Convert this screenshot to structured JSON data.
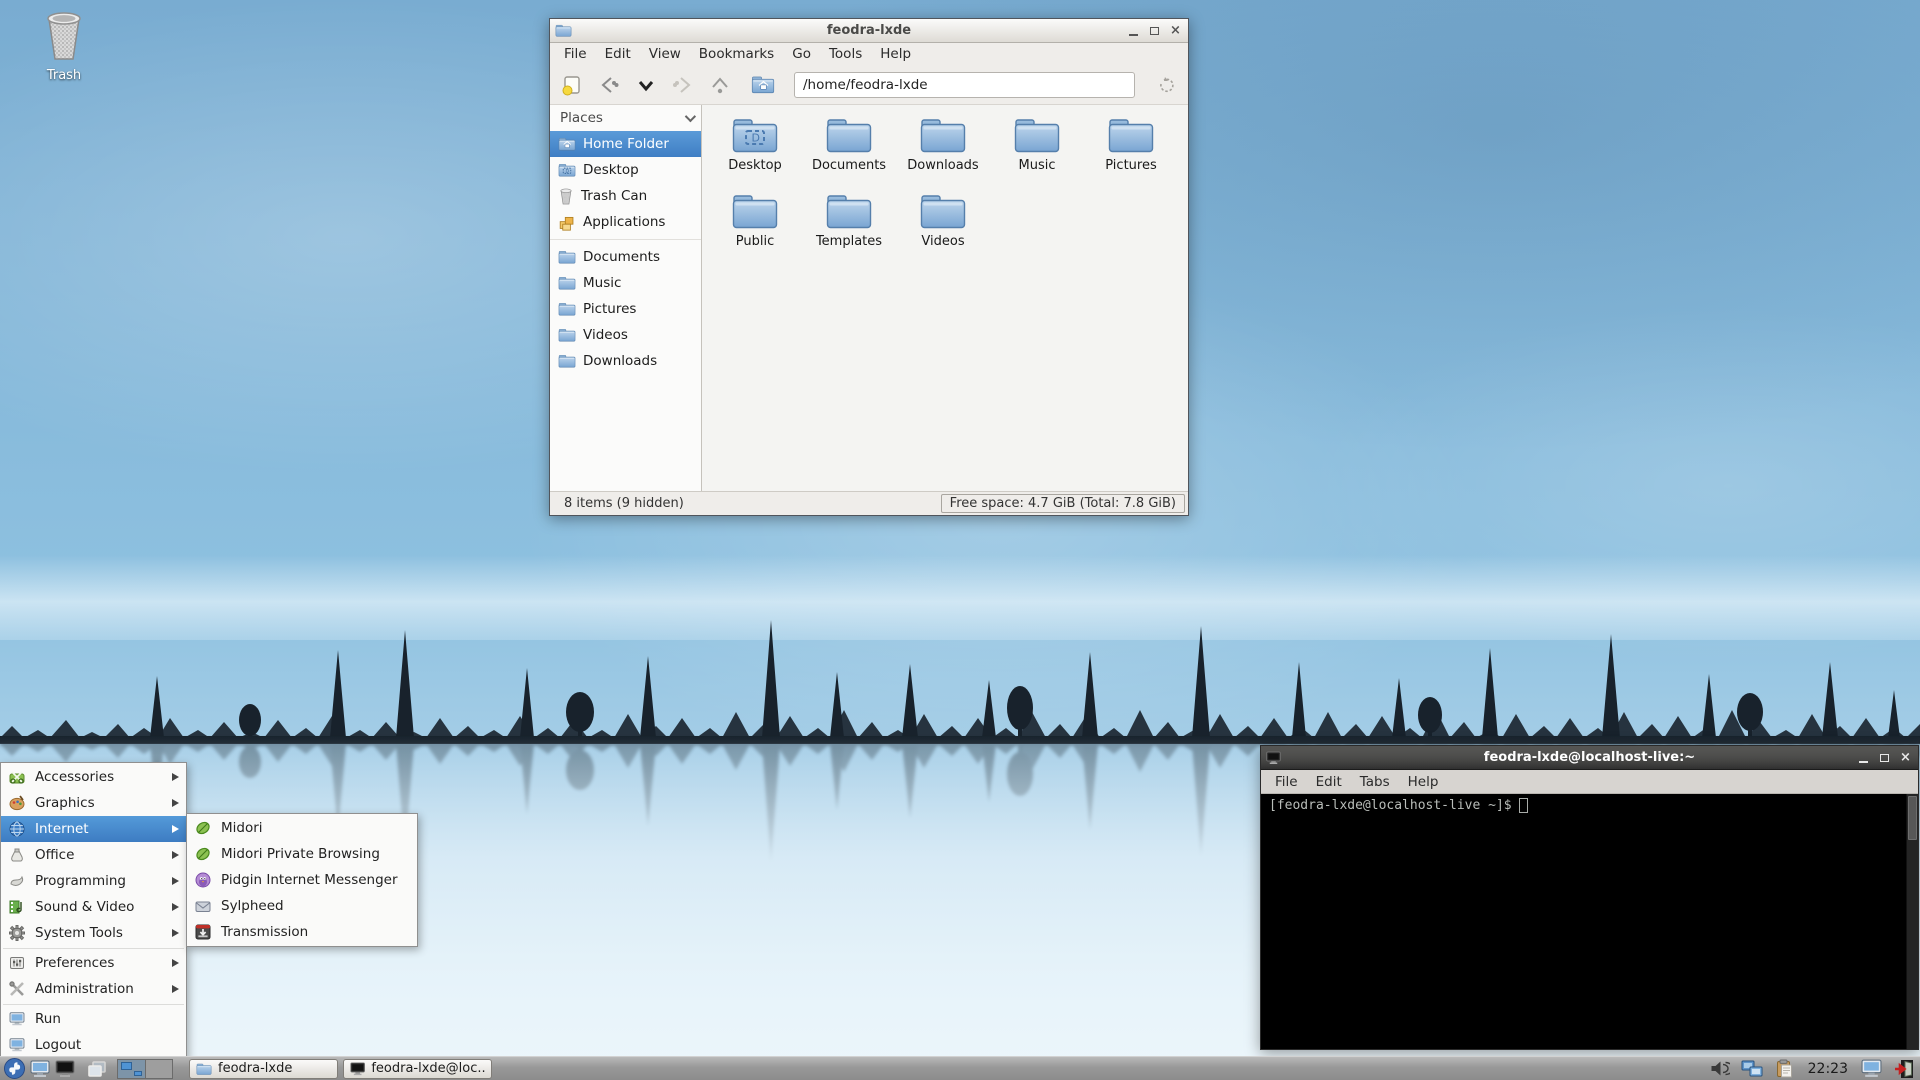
{
  "desktop": {
    "trash_label": "Trash"
  },
  "icons": {
    "close_glyph": "×",
    "window_buttons": [
      "minimize-icon",
      "maximize-icon",
      "close-icon"
    ],
    "toolbar": [
      "new-tab-icon",
      "back-icon",
      "history-dropdown-icon",
      "forward-icon",
      "up-icon",
      "home-icon",
      "jump-to-icon"
    ]
  },
  "colors": {
    "selection_blue": "#4a8fd3",
    "folder_blue": "#7fa9d4",
    "sky_blue": "#84b6d8",
    "tree_silhouette": "#18222c",
    "terminal_background": "#000000",
    "taskbar_gray": "#9a9a9a"
  },
  "file_manager": {
    "title": "feodra-lxde",
    "menu_items": [
      "File",
      "Edit",
      "View",
      "Bookmarks",
      "Go",
      "Tools",
      "Help"
    ],
    "address": "/home/feodra-lxde",
    "places_header": "Places",
    "places": [
      {
        "label": "Home Folder",
        "icon": "home-folder-icon",
        "selected": true
      },
      {
        "label": "Desktop",
        "icon": "desktop-folder-icon",
        "selected": false
      },
      {
        "label": "Trash Can",
        "icon": "trash-icon",
        "selected": false
      },
      {
        "label": "Applications",
        "icon": "applications-icon",
        "selected": false
      },
      {
        "label": "Documents",
        "icon": "folder-icon",
        "selected": false
      },
      {
        "label": "Music",
        "icon": "folder-icon",
        "selected": false
      },
      {
        "label": "Pictures",
        "icon": "folder-icon",
        "selected": false
      },
      {
        "label": "Videos",
        "icon": "folder-icon",
        "selected": false
      },
      {
        "label": "Downloads",
        "icon": "folder-icon",
        "selected": false
      }
    ],
    "folders": [
      "Desktop",
      "Documents",
      "Downloads",
      "Music",
      "Pictures",
      "Public",
      "Templates",
      "Videos"
    ],
    "status_left": "8 items (9 hidden)",
    "status_right": "Free space: 4.7 GiB (Total: 7.8 GiB)"
  },
  "terminal": {
    "title": "feodra-lxde@localhost-live:~",
    "menu_items": [
      "File",
      "Edit",
      "Tabs",
      "Help"
    ],
    "prompt": "[feodra-lxde@localhost-live ~]$"
  },
  "app_menu": {
    "categories": [
      "Accessories",
      "Graphics",
      "Internet",
      "Office",
      "Programming",
      "Sound & Video",
      "System Tools",
      "Preferences",
      "Administration"
    ],
    "actions": [
      "Run",
      "Logout"
    ],
    "highlighted": "Internet",
    "submenu": [
      "Midori",
      "Midori Private Browsing",
      "Pidgin Internet Messenger",
      "Sylpheed",
      "Transmission"
    ]
  },
  "taskbar": {
    "task_buttons": [
      "feodra-lxde",
      "feodra-lxde@loc..."
    ],
    "clock": "22:23"
  }
}
